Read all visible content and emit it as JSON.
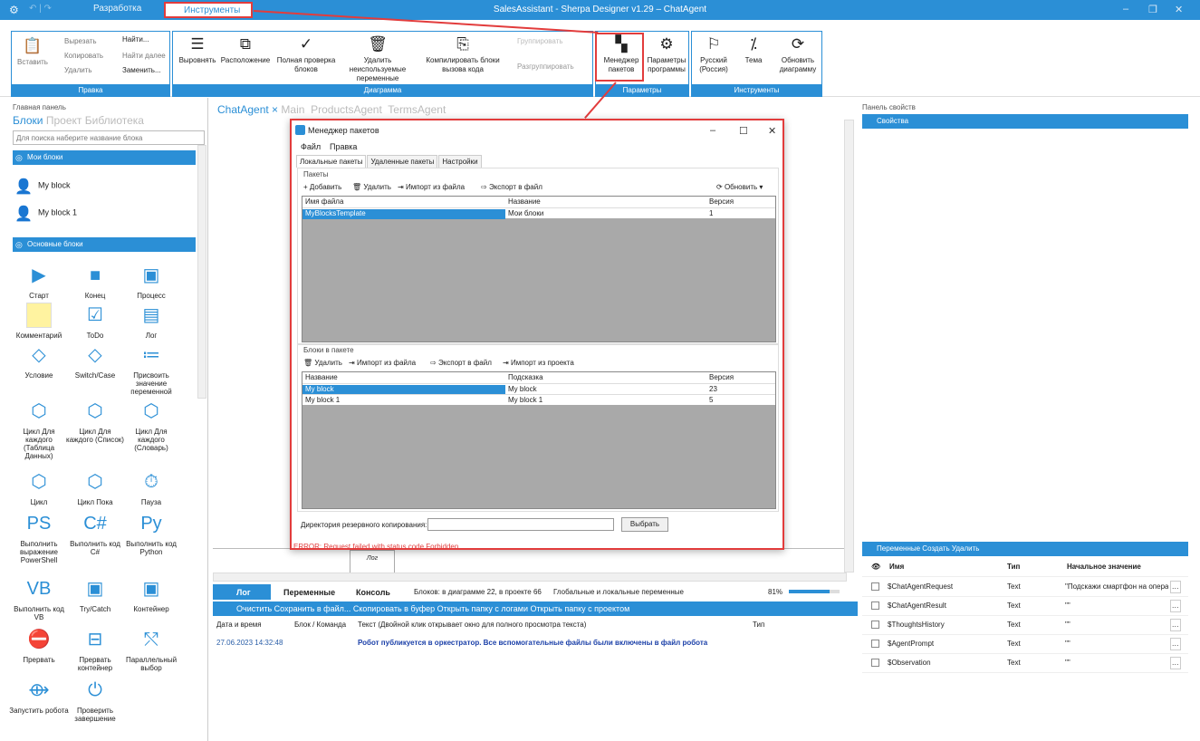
{
  "window": {
    "title": "SalesAssistant - Sherpa Designer v1.29 – ChatAgent",
    "tab_dev": "Разработка",
    "tab_tools": "Инструменты",
    "controls": [
      "–",
      "❐",
      "✕"
    ]
  },
  "ribbon": {
    "clipboard": {
      "paste": "Вставить",
      "cut": "Вырезать",
      "copy": "Копировать",
      "delete": "Удалить",
      "find": "Найти...",
      "find_next": "Найти далее",
      "replace": "Заменить...",
      "footer": "Правка"
    },
    "diagram": {
      "align": "Выровнять",
      "layout": "Расположение",
      "full_check": "Полная проверка блоков",
      "remove_unused": "Удалить неиспользуемые переменные",
      "compile": "Компилировать блоки вызова кода",
      "group": "Группировать",
      "ungroup": "Разгруппировать",
      "footer": "Диаграмма"
    },
    "params": {
      "package_manager": "Менеджер пакетов",
      "program_params": "Параметры программы",
      "footer": "Параметры"
    },
    "tools": {
      "language": "Русский (Россия)",
      "theme": "Тема",
      "refresh": "Обновить диаграмму",
      "footer": "Инструменты"
    }
  },
  "left": {
    "title": "Главная панель",
    "tabs": [
      "Блоки",
      "Проект",
      "Библиотека"
    ],
    "search_placeholder": "Для поиска наберите название блока",
    "my_blocks_header": "Мои блоки",
    "my_blocks": [
      "My block",
      "My block 1"
    ],
    "basic_header": "Основные блоки",
    "blocks": [
      "Старт",
      "Конец",
      "Процесс",
      "Комментарий",
      "ToDo",
      "Лог",
      "Условие",
      "Switch/Case",
      "Присвоить значение переменной",
      "Цикл Для каждого (Таблица Данных)",
      "Цикл Для каждого (Список)",
      "Цикл Для каждого (Словарь)",
      "Цикл",
      "Цикл Пока",
      "Пауза",
      "Выполнить выражение PowerShell",
      "Выполнить код C#",
      "Выполнить код Python",
      "Выполнить код VB",
      "Try/Catch",
      "Контейнер",
      "Прервать",
      "Прервать контейнер",
      "Параллельный выбор",
      "Запустить робота",
      "Проверить завершение"
    ]
  },
  "center": {
    "tabs": [
      "ChatAgent",
      "Main",
      "ProductsAgent",
      "TermsAgent"
    ],
    "node_label": "Лог"
  },
  "dialog": {
    "title": "Менеджер пакетов",
    "controls": [
      "–",
      "☐",
      "✕"
    ],
    "menu": [
      "Файл",
      "Правка"
    ],
    "tabs": [
      "Локальные пакеты",
      "Удаленные пакеты",
      "Настройки"
    ],
    "packages_label": "Пакеты",
    "pkg_toolbar": [
      "Добавить",
      "Удалить",
      "Импорт из файла",
      "Экспорт в файл"
    ],
    "refresh": "Обновить",
    "pkg_columns": [
      "Имя файла",
      "Название",
      "Версия"
    ],
    "pkg_rows": [
      [
        "MyBlocksTemplate",
        "Мои блоки",
        "1"
      ]
    ],
    "blocks_label": "Блоки в пакете",
    "blk_toolbar": [
      "Удалить",
      "Импорт из файла",
      "Экспорт в файл",
      "Импорт из проекта"
    ],
    "blk_columns": [
      "Название",
      "Подсказка",
      "Версия"
    ],
    "blk_rows": [
      [
        "My block",
        "My block",
        "23"
      ],
      [
        "My block 1",
        "My block 1",
        "5"
      ]
    ],
    "backup_label": "Директория резервного копирования:",
    "choose": "Выбрать",
    "error": "ERROR: Request failed with status code Forbidden"
  },
  "log": {
    "tabs": [
      "Лог",
      "Переменные",
      "Консоль"
    ],
    "status": "Блоков: в диаграмме 22, в проекте 66",
    "scope": "Глобальные и локальные переменные",
    "zoom": "81%",
    "actions": "Очистить  Сохранить в файл...  Скопировать в буфер  Открыть папку с логами  Открыть папку с проектом",
    "columns": [
      "Дата и время",
      "Блок / Команда",
      "Текст (Двойной клик открывает окно для полного просмотра текста)",
      "Тип"
    ],
    "row": {
      "time": "27.06.2023 14:32:48",
      "text": "Робот публикуется в оркестратор. Все вспомогательные файлы были включены в файл робота"
    }
  },
  "right": {
    "title": "Панель свойств",
    "props_header": "Свойства",
    "vars_header": "Переменные   Создать   Удалить",
    "var_columns": [
      "Имя",
      "Тип",
      "Начальное значение"
    ],
    "vars": [
      {
        "name": "$ChatAgentRequest",
        "type": "Text",
        "value": "\"Подскажи смартфон на опера"
      },
      {
        "name": "$ChatAgentResult",
        "type": "Text",
        "value": "\"\""
      },
      {
        "name": "$ThoughtsHistory",
        "type": "Text",
        "value": "\"\""
      },
      {
        "name": "$AgentPrompt",
        "type": "Text",
        "value": "\"\""
      },
      {
        "name": "$Observation",
        "type": "Text",
        "value": "\"\""
      }
    ]
  }
}
